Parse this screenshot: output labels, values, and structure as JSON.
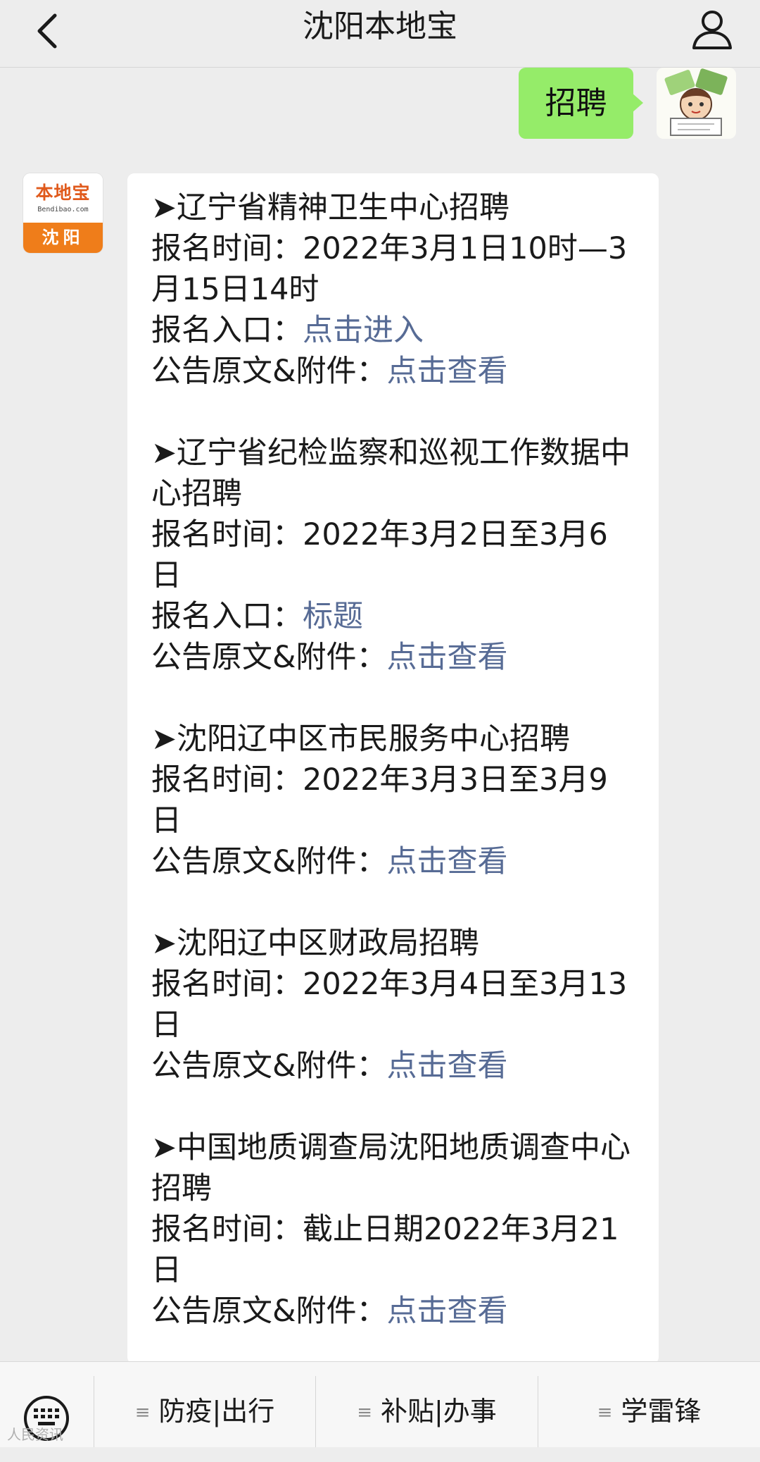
{
  "header": {
    "title": "沈阳本地宝"
  },
  "chat": {
    "user_message": "招聘",
    "bot_avatar": {
      "brand": "本地宝",
      "url": "Bendibao.com",
      "city": "沈阳"
    },
    "jobs": [
      {
        "title": "➤辽宁省精神卫生中心招聘",
        "time_label": "报名时间：",
        "time_value": "2022年3月1日10时—3月15日14时",
        "entry_label": "报名入口：",
        "entry_link": "点击进入",
        "notice_label": "公告原文&附件：",
        "notice_link": "点击查看"
      },
      {
        "title": "➤辽宁省纪检监察和巡视工作数据中心招聘",
        "time_label": "报名时间：",
        "time_value": "2022年3月2日至3月6日",
        "entry_label": "报名入口：",
        "entry_link": "标题",
        "notice_label": "公告原文&附件：",
        "notice_link": "点击查看"
      },
      {
        "title": "➤沈阳辽中区市民服务中心招聘",
        "time_label": "报名时间：",
        "time_value": "2022年3月3日至3月9日",
        "notice_label": "公告原文&附件：",
        "notice_link": "点击查看"
      },
      {
        "title": "➤沈阳辽中区财政局招聘",
        "time_label": "报名时间：",
        "time_value": "2022年3月4日至3月13日",
        "notice_label": "公告原文&附件：",
        "notice_link": "点击查看"
      },
      {
        "title": "➤中国地质调查局沈阳地质调查中心招聘",
        "time_label": "报名时间：",
        "time_value": "截止日期2022年3月21日",
        "notice_label": "公告原文&附件：",
        "notice_link": "点击查看"
      }
    ]
  },
  "menu": {
    "items": [
      {
        "label": "防疫|出行",
        "glyph": "≡"
      },
      {
        "label": "补贴|办事",
        "glyph": "≡"
      },
      {
        "label": "学雷锋",
        "glyph": "≡"
      }
    ]
  },
  "watermark": "人民资讯",
  "colors": {
    "link": "#576b95",
    "user_bubble": "#95ec69",
    "brand_orange": "#ef7d1a"
  },
  "icons": {
    "back": "chevron-left-icon",
    "user": "user-profile-icon",
    "keyboard": "keyboard-icon"
  }
}
